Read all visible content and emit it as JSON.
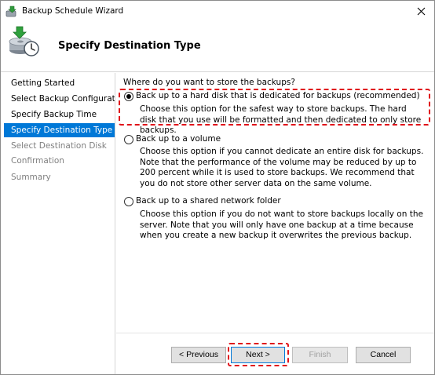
{
  "window": {
    "title": "Backup Schedule Wizard"
  },
  "header": {
    "title": "Specify Destination Type"
  },
  "steps": [
    {
      "label": "Getting Started",
      "state": "done"
    },
    {
      "label": "Select Backup Configurat...",
      "state": "done"
    },
    {
      "label": "Specify Backup Time",
      "state": "done"
    },
    {
      "label": "Specify Destination Type",
      "state": "active"
    },
    {
      "label": "Select Destination Disk",
      "state": "pending"
    },
    {
      "label": "Confirmation",
      "state": "pending"
    },
    {
      "label": "Summary",
      "state": "pending"
    }
  ],
  "main": {
    "question": "Where do you want to store the backups?",
    "options": [
      {
        "label": "Back up to a hard disk that is dedicated for backups (recommended)",
        "selected": true,
        "description": "Choose this option for the safest way to store backups. The hard disk that you use will be formatted and then dedicated to only store backups."
      },
      {
        "label": "Back up to a volume",
        "selected": false,
        "description": "Choose this option if you cannot dedicate an entire disk for backups. Note that the performance of the volume may be reduced by up to 200 percent while it is used to store backups. We recommend that you do not store other server data on the same volume."
      },
      {
        "label": "Back up to a shared network folder",
        "selected": false,
        "description": "Choose this option if you do not want to store backups locally on the server. Note that you will only have one backup at a time because when you create a new backup it overwrites the previous backup."
      }
    ]
  },
  "buttons": {
    "previous": "< Previous",
    "next": "Next >",
    "finish": "Finish",
    "cancel": "Cancel"
  },
  "colors": {
    "accent": "#0078d7",
    "highlight_box": "#e0131a"
  },
  "icons": {
    "app": "backup-wizard-icon",
    "header": "backup-disk-clock-icon",
    "close": "close-icon"
  }
}
